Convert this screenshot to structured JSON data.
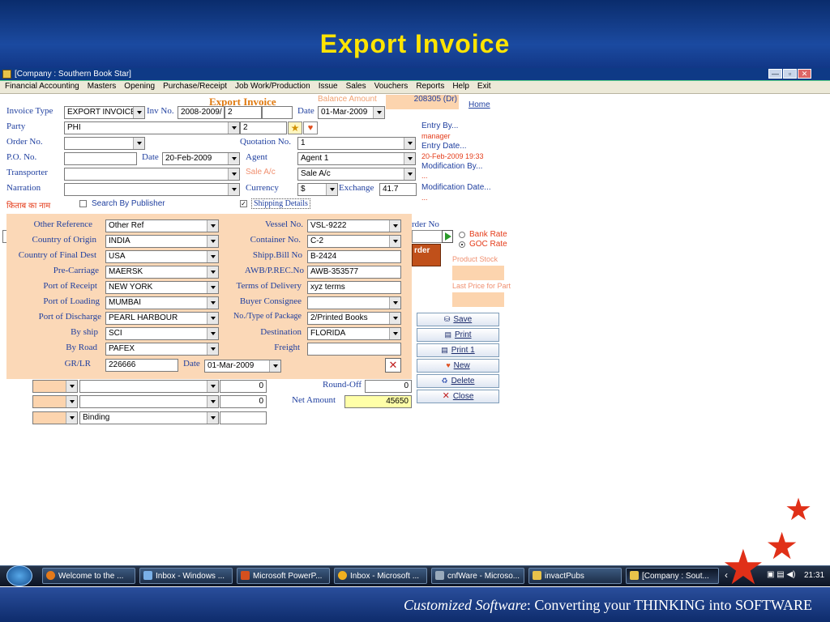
{
  "slide": {
    "title": "Export Invoice",
    "footer_italic": "Customized Software",
    "footer_rest": ":   Converting your THINKING into SOFTWARE"
  },
  "window": {
    "title": "[Company : Southern Book Star]",
    "min": "—",
    "max": "▫",
    "close": "✕"
  },
  "menu": [
    "Financial Accounting",
    "Masters",
    "Opening",
    "Purchase/Receipt",
    "Job Work/Production",
    "Issue",
    "Sales",
    "Vouchers",
    "Reports",
    "Help",
    "Exit"
  ],
  "form": {
    "heading": "Export Invoice",
    "balance_label": "Balance Amount",
    "balance_value": "208305 (Dr)",
    "home": "Home",
    "invoice_type_label": "Invoice Type",
    "invoice_type": "EXPORT INVOICE",
    "inv_no_label": "Inv No.",
    "inv_no_prefix": "2008-2009/",
    "inv_no": "2",
    "date_label": "Date",
    "date": "01-Mar-2009",
    "party_label": "Party",
    "party": "PHI",
    "party_code": "2",
    "order_no_label": "Order No.",
    "quotation_label": "Quotation No.",
    "quotation": "1",
    "po_label": "P.O. No.",
    "po_date_label": "Date",
    "po_date": "20-Feb-2009",
    "agent_label": "Agent",
    "agent": "Agent 1",
    "transporter_label": "Transporter",
    "sale_ac_label": "Sale A/c",
    "sale_ac": "Sale A/c",
    "narration_label": "Narration",
    "currency_label": "Currency",
    "currency": "$",
    "exchange_label": "Exchange",
    "exchange": "41.7",
    "hindi_label": "किताब का नाम",
    "search_publisher": "Search By Publisher",
    "shipping_details": "Shipping Details"
  },
  "entry": {
    "entry_by": "Entry  By...",
    "user": "manager",
    "entry_date": "Entry  Date...",
    "entry_date_value": "20-Feb-2009 19:33",
    "mod_by": "Modification  By...",
    "mod_by_value": "...",
    "mod_date": "Modification  Date...",
    "mod_date_value": "..."
  },
  "rates": {
    "bank": "Bank Rate",
    "goc": "GOC Rate",
    "product_stock": "Product Stock",
    "last_price": "Last Price for Part"
  },
  "behind": {
    "order_no": "rder No",
    "order_hdr": "rder"
  },
  "shipping": {
    "other_ref_label": "Other Reference",
    "other_ref": "Other Ref",
    "country_origin_label": "Country of Origin",
    "country_origin": "INDIA",
    "country_dest_label": "Country of Final Dest",
    "country_dest": "USA",
    "pre_carriage_label": "Pre-Carriage",
    "pre_carriage": "MAERSK",
    "port_receipt_label": "Port of Receipt",
    "port_receipt": "NEW YORK",
    "port_loading_label": "Port of Loading",
    "port_loading": "MUMBAI",
    "port_discharge_label": "Port of Discharge",
    "port_discharge": "PEARL HARBOUR",
    "by_ship_label": "By ship",
    "by_ship": "SCI",
    "by_road_label": "By Road",
    "by_road": "PAFEX",
    "grlr_label": "GR/LR",
    "grlr": "226666",
    "grlr_date_label": "Date",
    "grlr_date": "01-Mar-2009",
    "vessel_label": "Vessel No.",
    "vessel": "VSL-9222",
    "container_label": "Container No.",
    "container": "C-2",
    "shipp_bill_label": "Shipp.Bill No",
    "shipp_bill": "B-2424",
    "awb_label": "AWB/P.REC.No",
    "awb": "AWB-353577",
    "terms_label": "Terms of Delivery",
    "terms": "xyz terms",
    "buyer_label": "Buyer Consignee",
    "package_label": "No./Type of Package",
    "package": "2/Printed Books",
    "destination_label": "Destination",
    "destination": "FLORIDA",
    "freight_label": "Freight"
  },
  "totals": {
    "round_off_label": "Round-Off",
    "round_off": "0",
    "net_label": "Net Amount",
    "net": "45650",
    "row1_val": "0",
    "row2_val": "0",
    "row3_desc": "Binding"
  },
  "buttons": {
    "save": "Save",
    "print": "Print",
    "print1": "Print 1",
    "new": "New",
    "delete": "Delete",
    "close": "Close"
  },
  "taskbar": {
    "items": [
      "Welcome to the ...",
      "Inbox - Windows ...",
      "Microsoft PowerP...",
      "Inbox - Microsoft ...",
      "cnfWare - Microso...",
      "invactPubs",
      "[Company : Sout..."
    ],
    "time": "21:31"
  },
  "colors": {
    "header": "#0e3a86",
    "title": "#ffe400",
    "panel": "#fbd8b7",
    "label": "#1f3f9f",
    "accent_red": "#e43c1a",
    "star": "#e03018"
  }
}
